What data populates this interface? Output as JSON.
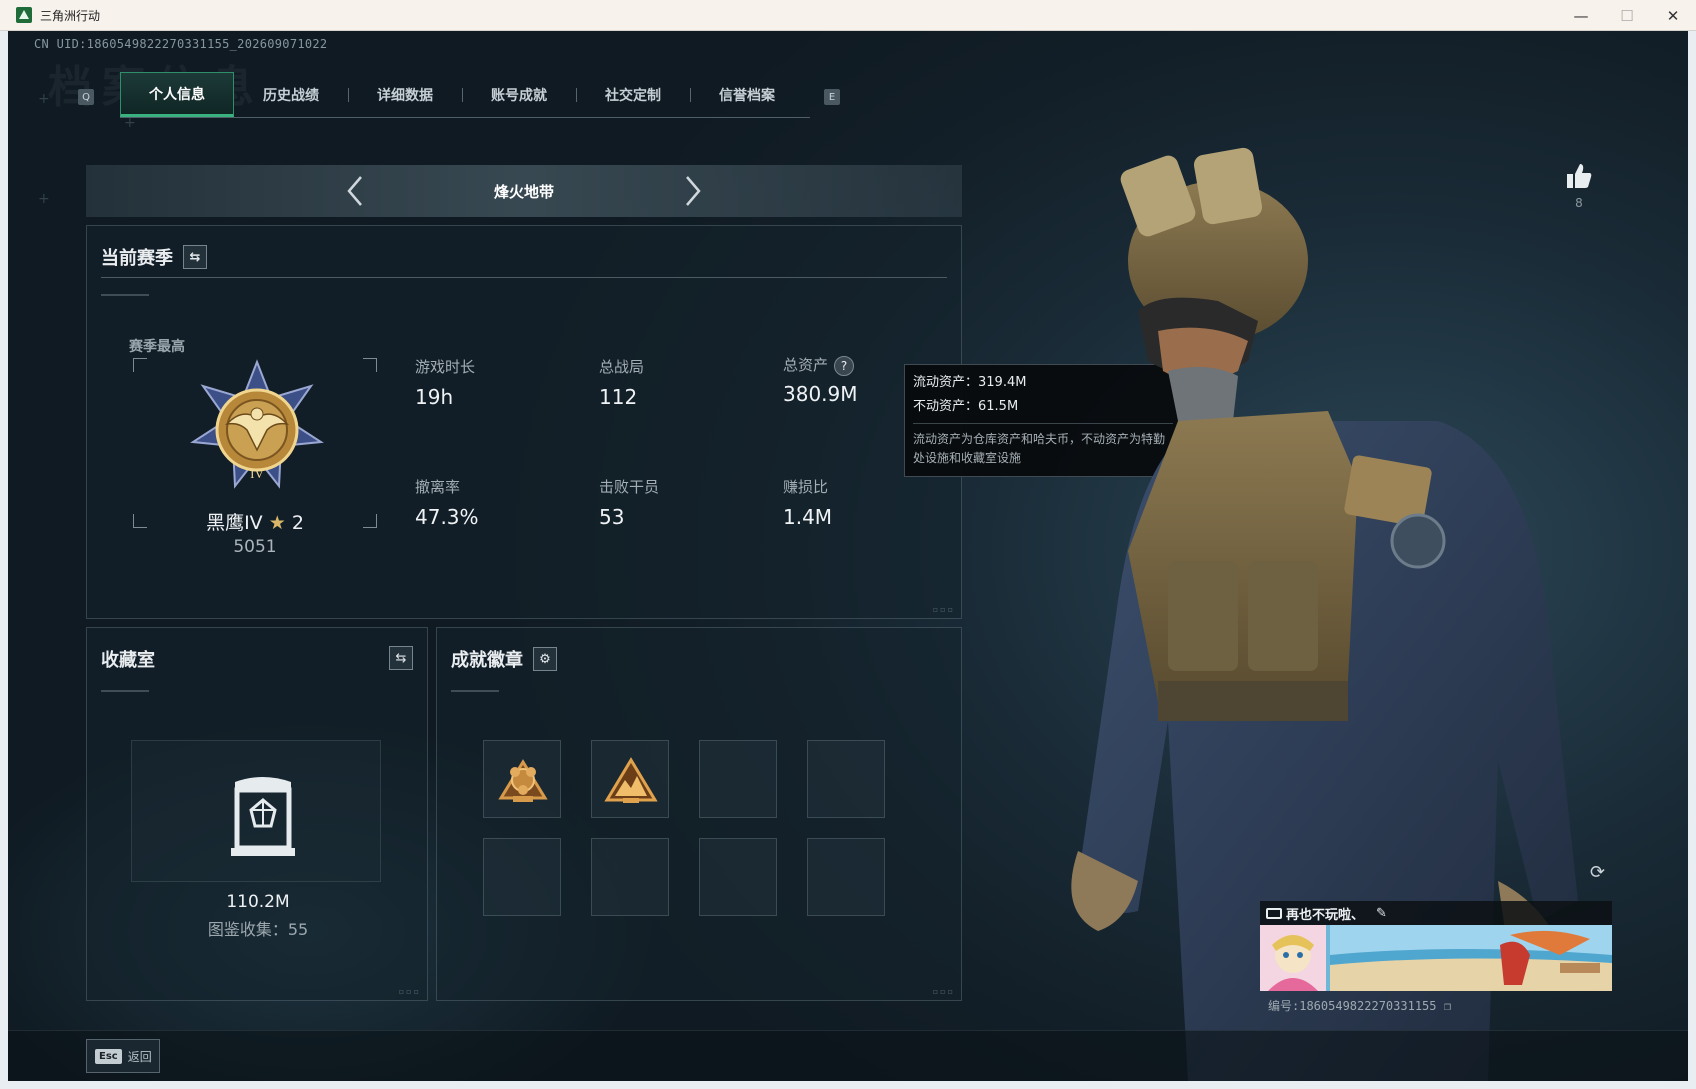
{
  "window": {
    "title": "三角洲行动",
    "minimize_glyph": "—",
    "maximize_glyph": "☐",
    "close_glyph": "✕"
  },
  "header": {
    "uid": "CN UID:1860549822270331155_202609071022",
    "ghost_title": "档案信息"
  },
  "tabs": {
    "key_left": "Q",
    "key_right": "E",
    "items": [
      {
        "label": "个人信息",
        "active": true
      },
      {
        "label": "历史战绩",
        "active": false
      },
      {
        "label": "详细数据",
        "active": false
      },
      {
        "label": "账号成就",
        "active": false
      },
      {
        "label": "社交定制",
        "active": false
      },
      {
        "label": "信誉档案",
        "active": false
      }
    ]
  },
  "mode": {
    "name": "烽火地带",
    "prev_icon": "chevron-left-icon",
    "next_icon": "chevron-right-icon"
  },
  "season": {
    "title": "当前赛季",
    "switch_icon": "swap-icon",
    "best_label": "赛季最高",
    "rank_name": "黑鹰IV",
    "rank_star_glyph": "★",
    "rank_stars": "2",
    "rank_score": "5051",
    "stats": [
      {
        "label": "游戏时长",
        "value": "19h"
      },
      {
        "label": "总战局",
        "value": "112"
      },
      {
        "label": "总资产",
        "value": "380.9M",
        "help": "?"
      },
      {
        "label": "撤离率",
        "value": "47.3%"
      },
      {
        "label": "击败干员",
        "value": "53"
      },
      {
        "label": "赚损比",
        "value": "1.4M"
      }
    ]
  },
  "tooltip": {
    "liquid": "流动资产：319.4M",
    "fixed": "不动资产：61.5M",
    "note": "流动资产为仓库资产和哈夫币，不动资产为特勤处设施和收藏室设施"
  },
  "collection": {
    "title": "收藏室",
    "switch_icon": "swap-icon",
    "value": "110.2M",
    "count_text": "图鉴收集：55"
  },
  "badges": {
    "title": "成就徽章",
    "settings_icon": "gear-icon",
    "settings_glyph": "⚙",
    "slots": [
      {
        "filled": true,
        "icon": "gear-emblem-badge-icon"
      },
      {
        "filled": true,
        "icon": "mountain-emblem-badge-icon"
      },
      {
        "filled": false
      },
      {
        "filled": false
      },
      {
        "filled": false
      },
      {
        "filled": false
      },
      {
        "filled": false
      },
      {
        "filled": false
      }
    ]
  },
  "like": {
    "count": "8",
    "icon": "thumbs-up-icon"
  },
  "namecard": {
    "name": "再也不玩啦、",
    "edit_glyph": "✎",
    "id_text": "编号:1860549822270331155",
    "copy_glyph": "❐",
    "refresh_glyph": "⟳"
  },
  "footer": {
    "esc_key": "Esc",
    "back_label": "返回"
  },
  "colors": {
    "accent": "#3ab27f",
    "gold": "#d8b768",
    "bg": "#131f28"
  }
}
